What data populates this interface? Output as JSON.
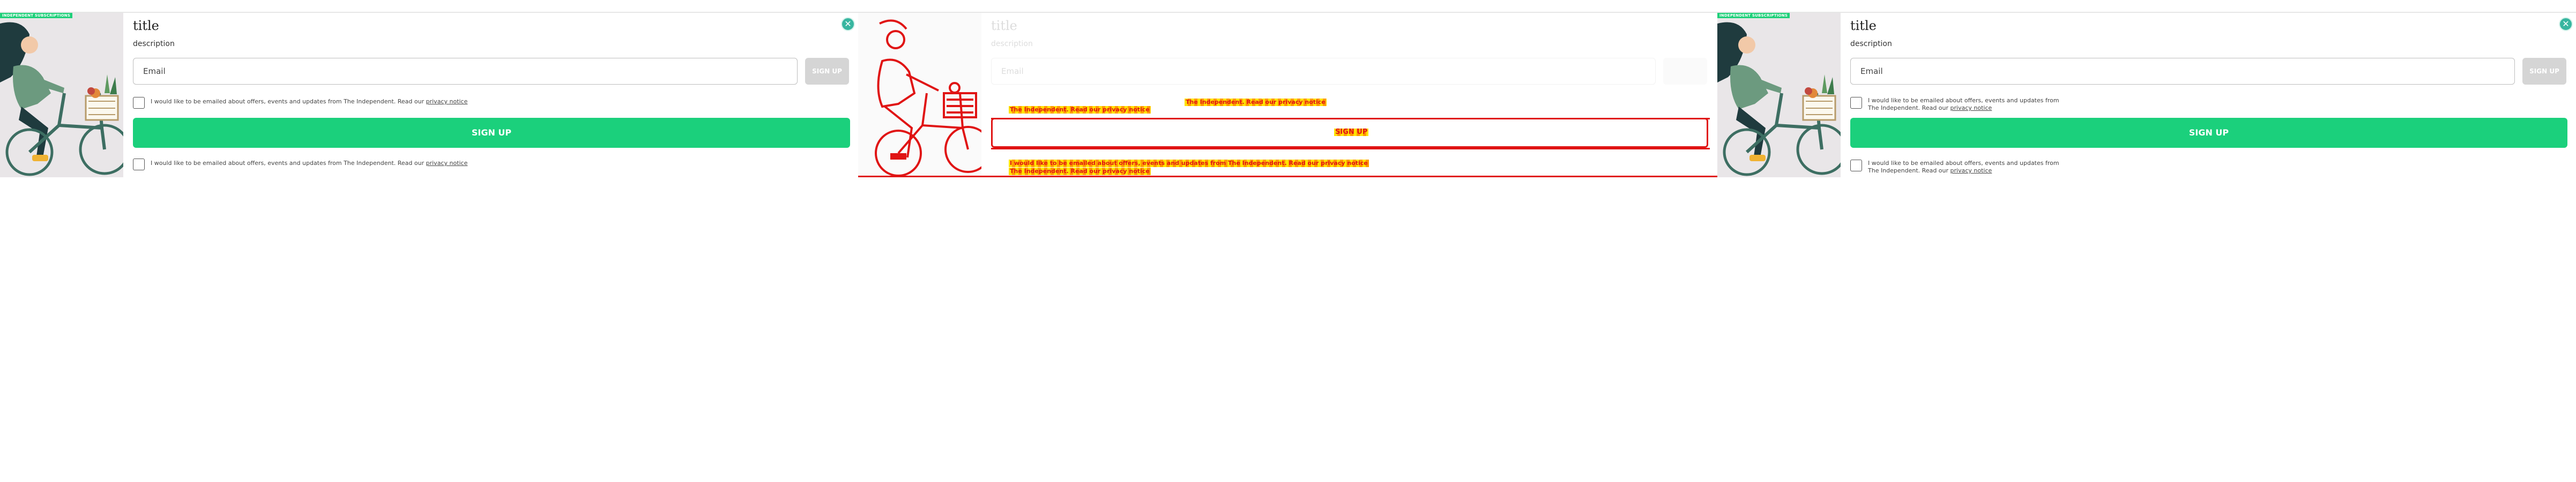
{
  "panels": [
    {
      "badge": "INDEPENDENT SUBSCRIPTIONS",
      "title": "title",
      "description": "description",
      "email_placeholder": "Email",
      "email_button": "SIGN UP",
      "checkbox1_text": "I would like to be emailed about offers, events and updates from The Independent. Read our ",
      "checkbox1_link": "privacy notice",
      "signup_button": "SIGN UP",
      "checkbox2_text": "I would like to be emailed about offers, events and updates from The Independent. Read our ",
      "checkbox2_link": "privacy notice"
    },
    {
      "title": "title",
      "description": "description",
      "email_placeholder": "Email",
      "glitch_line1": "The Independent. Read our privacy notice",
      "glitch_line2": "The Independent. Read our privacy notice",
      "signup_button": "SIGN UP",
      "glitch_line3": "I would like to be emailed about offers, events and updates from The Independent. Read our privacy notice",
      "glitch_line4": "The Independent. Read our privacy notice"
    },
    {
      "badge": "INDEPENDENT SUBSCRIPTIONS",
      "title": "title",
      "description": "description",
      "email_placeholder": "Email",
      "email_button": "SIGN UP",
      "checkbox1_line1": "I would like to be emailed about offers, events and updates from",
      "checkbox1_line2": "The Independent. Read our ",
      "checkbox1_link": "privacy notice",
      "signup_button": "SIGN UP",
      "checkbox2_line1": "I would like to be emailed about offers, events and updates from",
      "checkbox2_line2": "The Independent. Read our ",
      "checkbox2_link": "privacy notice"
    }
  ],
  "colors": {
    "accent": "#1bd07c",
    "close": "#38b6a0",
    "glitch_red": "#e01414",
    "glitch_yellow": "#ffe200"
  },
  "icons": {
    "close": "close-icon",
    "illustration": "cyclist-illustration",
    "checkbox": "checkbox"
  }
}
